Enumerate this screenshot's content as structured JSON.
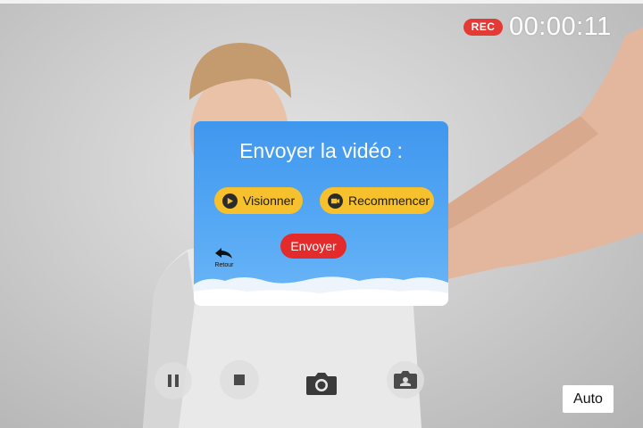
{
  "status": {
    "rec_label": "REC",
    "timer": "00:00:11"
  },
  "dialog": {
    "title": "Envoyer la vidéo :",
    "watch_label": "Visionner",
    "restart_label": "Recommencer",
    "send_label": "Envoyer",
    "back_label": "Retour"
  },
  "controls": {
    "auto_label": "Auto"
  },
  "icons": {
    "watch": "play-icon",
    "restart": "retry-video-icon",
    "back": "undo-arrow-icon",
    "pause": "pause-icon",
    "stop": "stop-icon",
    "capture": "camera-icon",
    "switch": "switch-camera-icon"
  },
  "colors": {
    "dialog_blue": "#4a9ff2",
    "pill_yellow": "#f6c12d",
    "send_red": "#e32b2b",
    "rec_red": "#e53935"
  }
}
